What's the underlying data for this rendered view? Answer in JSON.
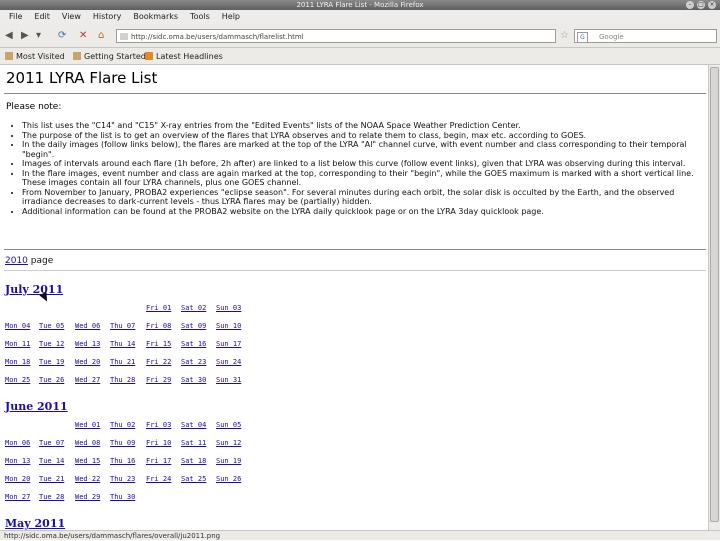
{
  "window": {
    "title": "2011 LYRA Flare List - Mozilla Firefox"
  },
  "menu": [
    "File",
    "Edit",
    "View",
    "History",
    "Bookmarks",
    "Tools",
    "Help"
  ],
  "nav": {
    "url": "http://sidc.oma.be/users/dammasch/flarelist.html",
    "search_placeholder": "Google"
  },
  "bookmarks": [
    "Most Visited",
    "Getting Started",
    "Latest Headlines"
  ],
  "page": {
    "title": "2011 LYRA Flare List",
    "note_title": "Please note:",
    "notes": [
      "This list uses the \"C14\" and \"C15\" X-ray entries from the \"Edited Events\" lists of the NOAA Space Weather Prediction Center.",
      "The purpose of the list is to get an overview of the flares that LYRA observes and to relate them to class, begin, max etc. according to GOES.",
      "In the daily images (follow links below), the flares are marked at the top of the LYRA \"Al\" channel curve, with event number and class corresponding to their temporal \"begin\".",
      "Images of intervals around each flare (1h before, 2h after) are linked to a list below this curve (follow event links), given that LYRA was observing during this interval.",
      "In the flare images, event number and class are again marked at the top, corresponding to their \"begin\", while the GOES maximum is marked with a short vertical line. These images contain all four LYRA channels, plus one GOES channel.",
      "From November to January, PROBA2 experiences \"eclipse season\". For several minutes during each orbit, the solar disk is occulted by the Earth, and the observed irradiance decreases to dark-current levels - thus LYRA flares may be (partially) hidden.",
      "Additional information can be found at the PROBA2 website on the LYRA daily quicklook page or on the LYRA 3day quicklook page."
    ],
    "year_link": "2010",
    "year_suffix": " page",
    "months": [
      {
        "title": "July 2011",
        "rows": [
          [
            "",
            "",
            "",
            "",
            "Fri 01",
            "Sat 02",
            "Sun 03"
          ],
          [
            "Mon 04",
            "Tue 05",
            "Wed 06",
            "Thu 07",
            "Fri 08",
            "Sat 09",
            "Sun 10"
          ],
          [
            "Mon 11",
            "Tue 12",
            "Wed 13",
            "Thu 14",
            "Fri 15",
            "Sat 16",
            "Sun 17"
          ],
          [
            "Mon 18",
            "Tue 19",
            "Wed 20",
            "Thu 21",
            "Fri 22",
            "Sat 23",
            "Sun 24"
          ],
          [
            "Mon 25",
            "Tue 26",
            "Wed 27",
            "Thu 28",
            "Fri 29",
            "Sat 30",
            "Sun 31"
          ]
        ]
      },
      {
        "title": "June 2011",
        "rows": [
          [
            "",
            "",
            "Wed 01",
            "Thu 02",
            "Fri 03",
            "Sat 04",
            "Sun 05"
          ],
          [
            "Mon 06",
            "Tue 07",
            "Wed 08",
            "Thu 09",
            "Fri 10",
            "Sat 11",
            "Sun 12"
          ],
          [
            "Mon 13",
            "Tue 14",
            "Wed 15",
            "Thu 16",
            "Fri 17",
            "Sat 18",
            "Sun 19"
          ],
          [
            "Mon 20",
            "Tue 21",
            "Wed 22",
            "Thu 23",
            "Fri 24",
            "Sat 25",
            "Sun 26"
          ],
          [
            "Mon 27",
            "Tue 28",
            "Wed 29",
            "Thu 30",
            "",
            "",
            ""
          ]
        ]
      },
      {
        "title": "May 2011",
        "rows": []
      }
    ]
  },
  "status": {
    "text": "http://sidc.oma.be/users/dammasch/flares/overall/ju2011.png"
  }
}
